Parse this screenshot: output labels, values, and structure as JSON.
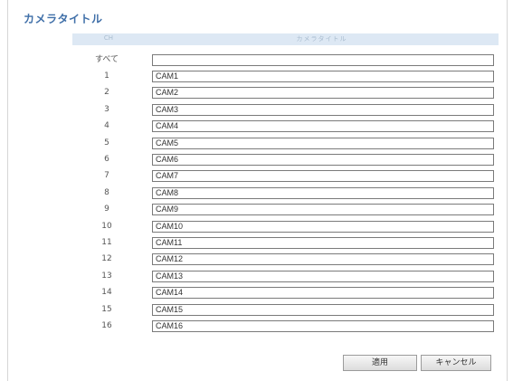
{
  "page": {
    "title": "カメラタイトル"
  },
  "table": {
    "col_ch": "CH",
    "col_title": "カメラタイトル",
    "all_label": "すべて",
    "all_value": "",
    "rows": [
      {
        "ch": "1",
        "value": "CAM1"
      },
      {
        "ch": "2",
        "value": "CAM2"
      },
      {
        "ch": "3",
        "value": "CAM3"
      },
      {
        "ch": "4",
        "value": "CAM4"
      },
      {
        "ch": "5",
        "value": "CAM5"
      },
      {
        "ch": "6",
        "value": "CAM6"
      },
      {
        "ch": "7",
        "value": "CAM7"
      },
      {
        "ch": "8",
        "value": "CAM8"
      },
      {
        "ch": "9",
        "value": "CAM9"
      },
      {
        "ch": "10",
        "value": "CAM10"
      },
      {
        "ch": "11",
        "value": "CAM11"
      },
      {
        "ch": "12",
        "value": "CAM12"
      },
      {
        "ch": "13",
        "value": "CAM13"
      },
      {
        "ch": "14",
        "value": "CAM14"
      },
      {
        "ch": "15",
        "value": "CAM15"
      },
      {
        "ch": "16",
        "value": "CAM16"
      }
    ]
  },
  "buttons": {
    "apply": "適用",
    "cancel": "キャンセル"
  }
}
